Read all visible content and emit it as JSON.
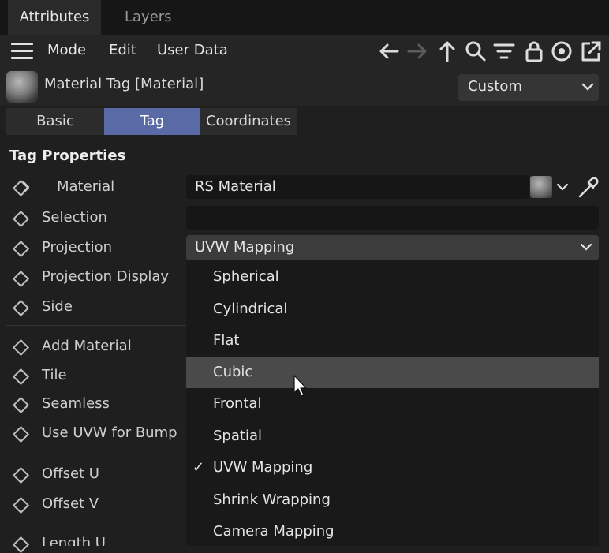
{
  "tabs": {
    "attributes": "Attributes",
    "layers": "Layers"
  },
  "menu": {
    "mode": "Mode",
    "edit": "Edit",
    "user_data": "User Data"
  },
  "header": {
    "title": "Material Tag [Material]",
    "preset": "Custom"
  },
  "subtabs": {
    "basic": "Basic",
    "tag": "Tag",
    "coordinates": "Coordinates"
  },
  "section": {
    "title": "Tag Properties"
  },
  "properties": {
    "material": {
      "label": "Material",
      "value": "RS Material"
    },
    "selection": {
      "label": "Selection",
      "value": ""
    },
    "projection": {
      "label": "Projection",
      "value": "UVW Mapping"
    },
    "projection_display": {
      "label": "Projection Display"
    },
    "side": {
      "label": "Side"
    },
    "add_material": {
      "label": "Add Material"
    },
    "tile": {
      "label": "Tile"
    },
    "seamless": {
      "label": "Seamless"
    },
    "use_uvw_bump": {
      "label": "Use UVW for Bump"
    },
    "offset_u": {
      "label": "Offset U"
    },
    "offset_v": {
      "label": "Offset V"
    },
    "length_u": {
      "label": "Length U"
    }
  },
  "projection_options": {
    "spherical": "Spherical",
    "cylindrical": "Cylindrical",
    "flat": "Flat",
    "cubic": "Cubic",
    "frontal": "Frontal",
    "spatial": "Spatial",
    "uvw_mapping": "UVW Mapping",
    "shrink_wrapping": "Shrink Wrapping",
    "camera_mapping": "Camera Mapping"
  },
  "check_mark": "✓",
  "colors": {
    "accent": "#5a6aa6",
    "highlight": "#4a4a4a",
    "background": "#1f1f1f"
  }
}
